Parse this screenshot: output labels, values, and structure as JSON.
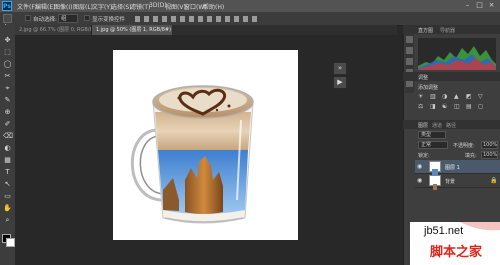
{
  "app": {
    "logo": "Ps"
  },
  "menu": [
    "文件(F)",
    "编辑(E)",
    "图像(I)",
    "图层(L)",
    "文字(Y)",
    "选择(S)",
    "滤镜(T)",
    "3D(D)",
    "视图(V)",
    "窗口(W)",
    "帮助(H)"
  ],
  "window_controls": [
    "–",
    "□",
    "×"
  ],
  "options": {
    "auto_select_label": "自动选择:",
    "auto_select_value": "组",
    "show_transform_label": "显示变换控件"
  },
  "tabs": [
    {
      "label": "2.jpg @ 66.7% (图层 0, RGB/8) ×",
      "active": false
    },
    {
      "label": "1.jpg @ 50% (图层 1, RGB/8#) * ×",
      "active": true
    }
  ],
  "histogram": {
    "tabs": [
      "直方图",
      "导航器"
    ]
  },
  "adjustments": {
    "title": "调整",
    "subtitle": "添加调整"
  },
  "layers": {
    "tabs": [
      "图层",
      "通道",
      "路径"
    ],
    "kind_label": "类型",
    "blend_mode": "正常",
    "opacity_label": "不透明度:",
    "opacity_value": "100%",
    "lock_label": "锁定:",
    "fill_label": "填充:",
    "fill_value": "100%",
    "items": [
      {
        "name": "图层 1"
      },
      {
        "name": "背景"
      }
    ]
  },
  "watermark": {
    "site": "jb51.net",
    "name": "脚本之家"
  },
  "colors": {
    "accent_blue": "#31a8ff",
    "watermark_red": "#e0251b"
  }
}
